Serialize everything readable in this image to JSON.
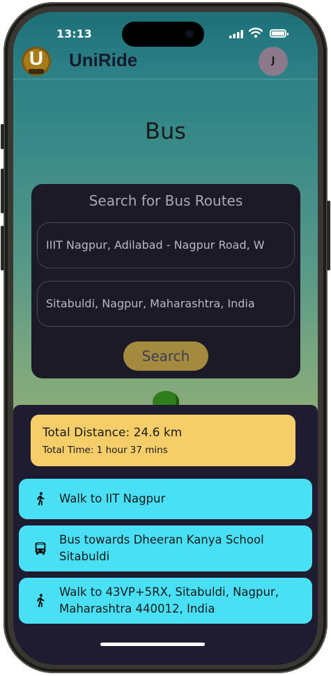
{
  "status_bar": {
    "time": "13:13"
  },
  "header": {
    "app_name": "UniRide",
    "logo_letter": "U",
    "avatar_initial": "J"
  },
  "page": {
    "title": "Bus"
  },
  "search_card": {
    "title": "Search for Bus Routes",
    "from_value": "IIIT Nagpur, Adilabad - Nagpur Road, W",
    "to_value": "Sitabuldi, Nagpur, Maharashtra, India",
    "search_label": "Search"
  },
  "summary": {
    "distance": "Total Distance: 24.6 km",
    "time": "Total Time: 1 hour 37 mins"
  },
  "steps": [
    {
      "icon": "walk-icon",
      "text": "Walk to IIT Nagpur"
    },
    {
      "icon": "bus-icon",
      "text": "Bus towards Dheeran Kanya School Sitabuldi"
    },
    {
      "icon": "walk-icon",
      "text": "Walk to 43VP+5RX, Sitabuldi, Nagpur, Maharashtra 440012, India"
    }
  ],
  "colors": {
    "accent_gold": "#a48a3c",
    "summary_bg": "#f5ce6a",
    "step_bg": "#49e0f5",
    "sheet_bg": "#1f1b30",
    "card_bg": "#1c1a26"
  }
}
